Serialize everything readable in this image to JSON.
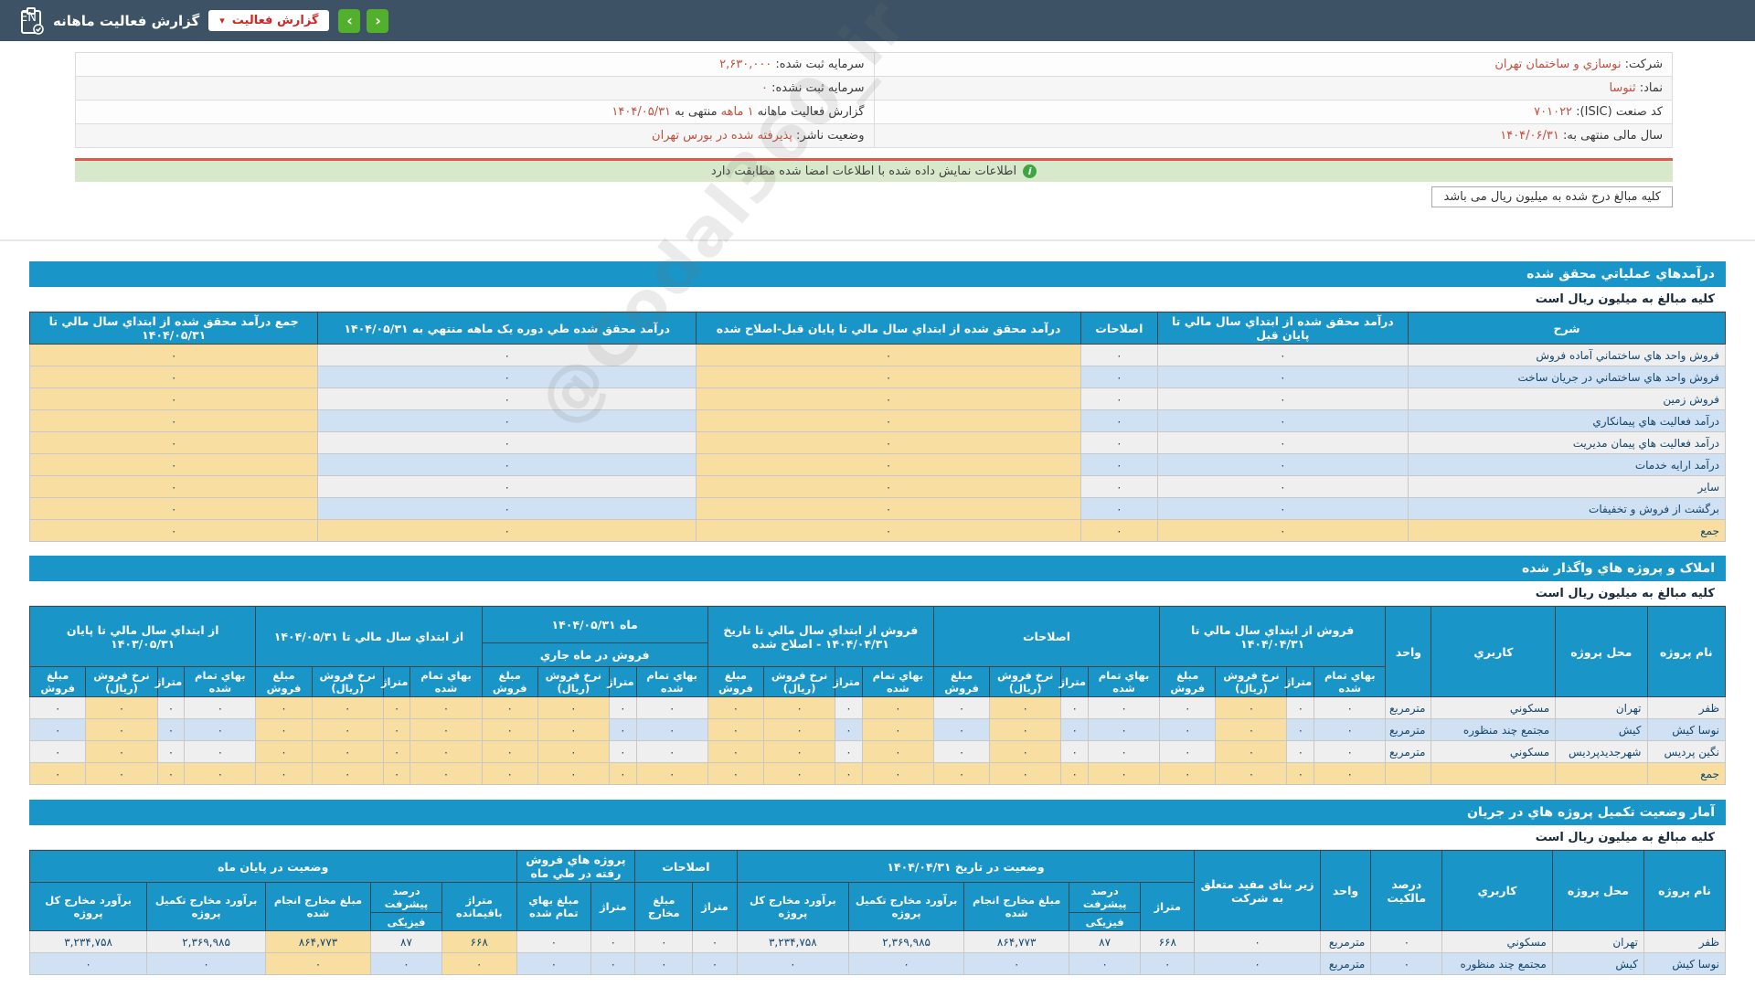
{
  "top_bar": {
    "language": "EN",
    "title": "گزارش فعالیت ماهانه",
    "dropdown_label": "گزارش فعالیت",
    "dropdown_caret": "▾",
    "prev_label": "‹",
    "next_label": "›"
  },
  "watermark": "@Codal360_ir",
  "company_info": {
    "rows": [
      {
        "right": {
          "label": "شرکت:",
          "value": "نوسازي و ساختمان تهران"
        },
        "left": {
          "label": "سرمایه ثبت شده:",
          "value": "۲,۶۳۰,۰۰۰"
        }
      },
      {
        "right": {
          "label": "نماد:",
          "value": "ثنوسا"
        },
        "left": {
          "label": "سرمایه ثبت نشده:",
          "value": "۰"
        }
      },
      {
        "right": {
          "label": "کد صنعت (ISIC):",
          "value": "۷۰۱۰۲۲"
        },
        "left": {
          "parts": [
            {
              "text": "گزارش فعالیت ماهانه ",
              "accent": false
            },
            {
              "text": "۱ ماهه",
              "accent": true
            },
            {
              "text": " منتهی به ",
              "accent": false
            },
            {
              "text": "۱۴۰۴/۰۵/۳۱",
              "accent": true
            }
          ]
        }
      },
      {
        "right": {
          "label": "سال مالی منتهی به:",
          "value": "۱۴۰۴/۰۶/۳۱"
        },
        "left": {
          "label": "وضعیت ناشر:",
          "value": "پذیرفته شده در بورس تهران"
        }
      }
    ]
  },
  "signed_notice": "اطلاعات نمایش داده شده با اطلاعات امضا شده مطابقت دارد",
  "notice_icon": "i",
  "amounts_box": "کلیه مبالغ درج شده به میلیون ریال می باشد",
  "amounts_subtitle": "کلیه مبالغ به میلیون ریال است",
  "section1": {
    "title": "درآمدهاي عملياتي محقق شده",
    "columns": [
      "شرح",
      "درآمد محقق شده از ابتداي سال مالي تا پايان قبل",
      "اصلاحات",
      "درآمد محقق شده از ابتداي سال مالي تا پايان قبل-اصلاح شده",
      "درآمد محقق شده طي دوره يک ماهه منتهي به ۱۴۰۴/۰۵/۳۱",
      "جمع درآمد محقق شده از ابتداي سال مالي تا ۱۴۰۴/۰۵/۳۱"
    ],
    "rows": [
      {
        "label": "فروش واحد هاي ساختماني آماده فروش",
        "values": [
          "۰",
          "۰",
          "۰",
          "۰",
          "۰"
        ]
      },
      {
        "label": "فروش واحد هاي ساختماني در جريان ساخت",
        "values": [
          "۰",
          "۰",
          "۰",
          "۰",
          "۰"
        ]
      },
      {
        "label": "فروش زمين",
        "values": [
          "۰",
          "۰",
          "۰",
          "۰",
          "۰"
        ]
      },
      {
        "label": "درآمد فعاليت هاي پيمانکاري",
        "values": [
          "۰",
          "۰",
          "۰",
          "۰",
          "۰"
        ]
      },
      {
        "label": "درآمد فعاليت هاي پيمان مديريت",
        "values": [
          "۰",
          "۰",
          "۰",
          "۰",
          "۰"
        ]
      },
      {
        "label": "درآمد ارايه خدمات",
        "values": [
          "۰",
          "۰",
          "۰",
          "۰",
          "۰"
        ]
      },
      {
        "label": "ساير",
        "values": [
          "۰",
          "۰",
          "۰",
          "۰",
          "۰"
        ]
      },
      {
        "label": "برگشت از فروش و تخفيفات",
        "values": [
          "۰",
          "۰",
          "۰",
          "۰",
          "۰"
        ]
      },
      {
        "label": "جمع",
        "values": [
          "۰",
          "۰",
          "۰",
          "۰",
          "۰"
        ],
        "total": true
      }
    ]
  },
  "section2": {
    "title": "املاک و پروژه هاي واگذار شده",
    "fixed_columns": [
      "نام پروژه",
      "محل پروژه",
      "کاربري",
      "واحد"
    ],
    "groups": [
      "فروش از ابتداي سال مالي تا ۱۴۰۴/۰۴/۳۱",
      "اصلاحات",
      "فروش از ابتداي سال مالي تا تاريخ ۱۴۰۴/۰۴/۳۱ - اصلاح شده",
      "ماه ۱۴۰۴/۰۵/۳۱",
      "از ابتداي سال مالي تا ۱۴۰۴/۰۵/۳۱",
      "از ابتداي سال مالي تا پايان ۱۴۰۳/۰۵/۳۱"
    ],
    "month_sub": "فروش در ماه جاري",
    "sub_columns": [
      "بهاي تمام شده",
      "متراژ",
      "نرخ فروش (ريال)",
      "مبلغ فروش"
    ],
    "rows": [
      {
        "name": "ظفر",
        "location": "تهران",
        "usage": "مسکوني",
        "unit": "مترمربع",
        "values": [
          "۰",
          "۰",
          "۰",
          "۰",
          "۰",
          "۰",
          "۰",
          "۰",
          "۰",
          "۰",
          "۰",
          "۰",
          "۰",
          "۰",
          "۰",
          "۰",
          "۰",
          "۰",
          "۰",
          "۰",
          "۰",
          "۰",
          "۰",
          "۰"
        ]
      },
      {
        "name": "نوسا کيش",
        "location": "کيش",
        "usage": "مجتمع چند منظوره",
        "unit": "مترمربع",
        "values": [
          "۰",
          "۰",
          "۰",
          "۰",
          "۰",
          "۰",
          "۰",
          "۰",
          "۰",
          "۰",
          "۰",
          "۰",
          "۰",
          "۰",
          "۰",
          "۰",
          "۰",
          "۰",
          "۰",
          "۰",
          "۰",
          "۰",
          "۰",
          "۰"
        ]
      },
      {
        "name": "نگين پرديس",
        "location": "شهرجديدپرديس",
        "usage": "مسکوني",
        "unit": "مترمربع",
        "values": [
          "۰",
          "۰",
          "۰",
          "۰",
          "۰",
          "۰",
          "۰",
          "۰",
          "۰",
          "۰",
          "۰",
          "۰",
          "۰",
          "۰",
          "۰",
          "۰",
          "۰",
          "۰",
          "۰",
          "۰",
          "۰",
          "۰",
          "۰",
          "۰"
        ]
      },
      {
        "name": "جمع",
        "location": "",
        "usage": "",
        "unit": "",
        "total": true,
        "values": [
          "۰",
          "۰",
          "۰",
          "۰",
          "۰",
          "۰",
          "۰",
          "۰",
          "۰",
          "۰",
          "۰",
          "۰",
          "۰",
          "۰",
          "۰",
          "۰",
          "۰",
          "۰",
          "۰",
          "۰",
          "۰",
          "۰",
          "۰",
          "۰"
        ]
      }
    ]
  },
  "section3": {
    "title": "آمار وضعیت تکمیل پروژه هاي در جریان",
    "fixed_columns": [
      "نام پروژه",
      "محل پروژه",
      "کاربري",
      "درصد مالکیت",
      "واحد",
      "زیر بنای مفید متعلق به شرکت"
    ],
    "groups": [
      {
        "label": "وضعیت در تاریخ ۱۴۰۴/۰۴/۳۱",
        "cols": [
          "متراژ",
          "درصد پیشرفت|فیزیکی",
          "مبلغ مخارج انجام شده",
          "برآورد مخارج تکمیل پروژه",
          "برآورد مخارج کل پروژه"
        ]
      },
      {
        "label": "اصلاحات",
        "cols": [
          "متراژ",
          "مبلغ مخارج"
        ]
      },
      {
        "label": "پروژه هاي فروش رفته در طي ماه",
        "cols": [
          "متراژ",
          "مبلغ بهاي تمام شده"
        ]
      },
      {
        "label": "وضعیت در پایان ماه",
        "cols": [
          "متراژ باقیمانده",
          "درصد پیشرفت|فیزیکی",
          "مبلغ مخارج انجام شده",
          "برآورد مخارج تکمیل پروژه",
          "برآورد مخارج کل پروژه"
        ]
      }
    ],
    "rows": [
      {
        "name": "ظفر",
        "location": "تهران",
        "usage": "مسکوني",
        "ownership": "۰",
        "unit": "مترمربع",
        "useful_area": "۰",
        "values": [
          "۶۶۸",
          "۸۷",
          "۸۶۴,۷۷۳",
          "۲,۳۶۹,۹۸۵",
          "۳,۲۳۴,۷۵۸",
          "۰",
          "۰",
          "۰",
          "۰",
          "۶۶۸",
          "۸۷",
          "۸۶۴,۷۷۳",
          "۲,۳۶۹,۹۸۵",
          "۳,۲۳۴,۷۵۸"
        ]
      },
      {
        "name": "نوسا کيش",
        "location": "کيش",
        "usage": "مجتمع چند منظوره",
        "ownership": "۰",
        "unit": "مترمربع",
        "useful_area": "۰",
        "partial": true,
        "values": [
          "۰",
          "۰",
          "۰",
          "۰",
          "۰",
          "۰",
          "۰",
          "۰",
          "۰",
          "۰",
          "۰",
          "۰",
          "۰",
          "۰"
        ]
      }
    ]
  }
}
